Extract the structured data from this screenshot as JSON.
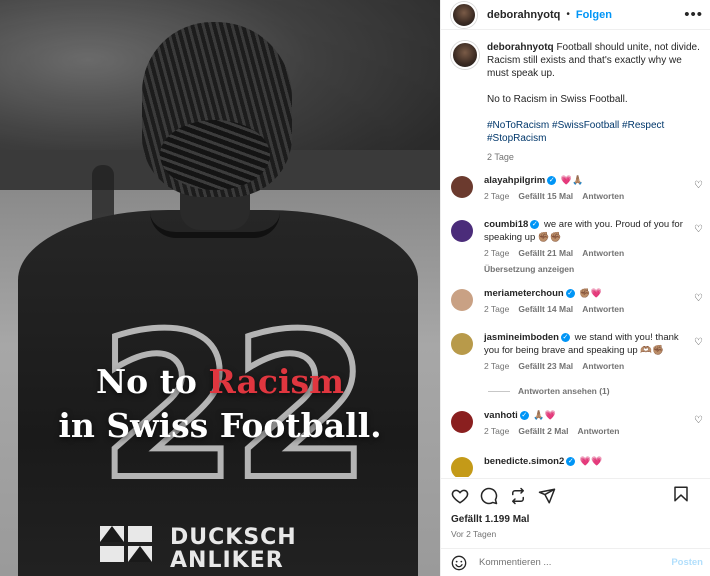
{
  "post": {
    "username": "deborahnyotq",
    "follow_label": "Folgen",
    "dot": "•",
    "more_icon": "more-horizontal-icon"
  },
  "image": {
    "overlay_line1_a": "No to ",
    "overlay_line1_b": "Racism",
    "overlay_line2": "in Swiss Football.",
    "jersey_number": "22",
    "sponsor_line1": "DUCKSCH",
    "sponsor_line2": "ANLIKER",
    "accent_color": "#e0363f"
  },
  "caption": {
    "username": "deborahnyotq",
    "text": "Football should unite, not divide. Racism still exists and that's exactly why we must speak up.",
    "line2": "No to Racism in Swiss Football.",
    "tags": "#NoToRacism #SwissFootball #Respect #StopRacism",
    "time": "2 Tage"
  },
  "comments": [
    {
      "username": "alayahpilgrim",
      "text": "💗🙏🏽",
      "time": "2 Tage",
      "likes": "Gefällt 15 Mal",
      "reply": "Antworten",
      "color": "#6b3a2e"
    },
    {
      "username": "coumbi18",
      "text": "we are with you. Proud of you for speaking up ✊🏽✊🏽",
      "time": "2 Tage",
      "likes": "Gefällt 21 Mal",
      "reply": "Antworten",
      "translate": "Übersetzung anzeigen",
      "color": "#4b2c7a"
    },
    {
      "username": "meriameterchoun",
      "text": "✊🏽💗",
      "time": "2 Tage",
      "likes": "Gefällt 14 Mal",
      "reply": "Antworten",
      "color": "#c9a184"
    },
    {
      "username": "jasmineimboden",
      "text": "we stand with you! thank you for being brave and speaking up 🫶🏽✊🏽",
      "time": "2 Tage",
      "likes": "Gefällt 23 Mal",
      "reply": "Antworten",
      "view_replies": "Antworten ansehen (1)",
      "color": "#b89a4a"
    },
    {
      "username": "vanhoti",
      "text": "🙏🏽💗",
      "time": "2 Tage",
      "likes": "Gefällt 2 Mal",
      "reply": "Antworten",
      "color": "#8a1f1f"
    },
    {
      "username": "benedicte.simon2",
      "text": "💗💗",
      "color": "#c49a18"
    }
  ],
  "actions": {
    "likes": "Gefällt 1.199 Mal",
    "date": "Vor 2 Tagen",
    "icons": [
      "heart-icon",
      "comment-icon",
      "share-icon",
      "send-icon",
      "bookmark-icon"
    ]
  },
  "comment_box": {
    "placeholder": "Kommentieren ...",
    "post_label": "Posten",
    "emoji_icon": "smiley-icon"
  }
}
